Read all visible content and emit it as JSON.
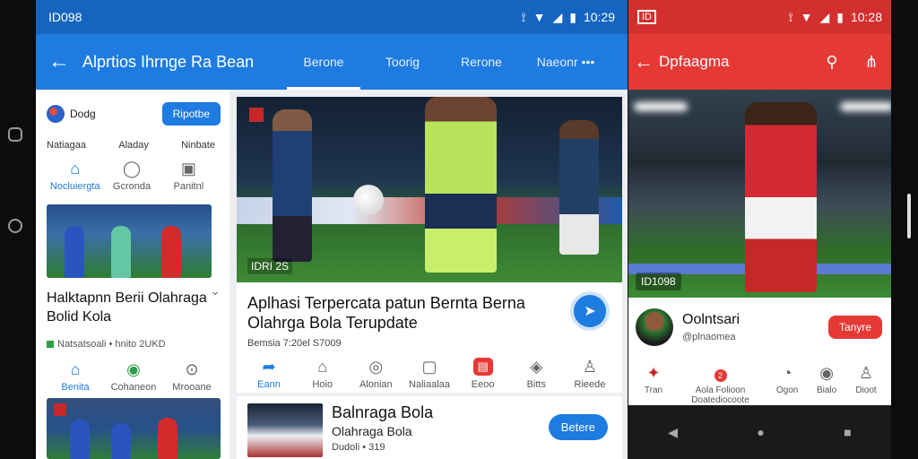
{
  "main": {
    "status": {
      "time_left": "ID098",
      "time_right": "10:29"
    },
    "appbar": {
      "title": "Alprtios Ihrnge Ra Bean"
    },
    "tabs": [
      {
        "label": "Berone",
        "active": true
      },
      {
        "label": "Toorig"
      },
      {
        "label": "Rerone"
      },
      {
        "label": "Naeonr •••"
      }
    ],
    "left_card": {
      "brand": "Dodg",
      "button": "Ripotbe",
      "tri_labels": [
        "Natiagaa",
        "Aladay",
        "Ninbate"
      ],
      "icons": [
        {
          "label": "Nocluiergta",
          "icon": "home-icon",
          "active": true
        },
        {
          "label": "Gcronda",
          "icon": "chat-icon"
        },
        {
          "label": "Panitnl",
          "icon": "image-icon"
        }
      ],
      "headline": "Halktapnn Berii Olahraga Bolid Kola",
      "meta": "Natsatsoali • hnito  2UKD",
      "icons2": [
        {
          "label": "Benita",
          "icon": "home-icon",
          "active": true
        },
        {
          "label": "Cohaneon",
          "icon": "circle-icon"
        },
        {
          "label": "Mrooane",
          "icon": "download-icon"
        }
      ]
    },
    "hero": {
      "label": "IDRI 2S"
    },
    "mid_card": {
      "title": "Aplhasi Terpercata patun Bernta Berna Olahrga Bola Terupdate",
      "meta": "Bemsia  7:20el S7009",
      "icons": [
        {
          "label": "Eann",
          "icon": "share-icon",
          "active": true
        },
        {
          "label": "Hoio",
          "icon": "home-icon"
        },
        {
          "label": "Alonian",
          "icon": "location-icon"
        },
        {
          "label": "Naliaalaa",
          "icon": "gamepad-icon"
        },
        {
          "label": "Eeoo",
          "icon": "bookmark-icon",
          "red": true
        },
        {
          "label": "Bitts",
          "icon": "shield-icon"
        },
        {
          "label": "Rieede",
          "icon": "profile-icon"
        }
      ]
    },
    "card2": {
      "title": "Balnraga Bola",
      "sub": "Olahraga Bola",
      "meta": "Dudoli • 319",
      "button": "Betere"
    }
  },
  "right": {
    "status": {
      "badge": "ID",
      "time": "10:28"
    },
    "appbar": {
      "title": "Dpfaagma"
    },
    "hero": {
      "label": "ID1098"
    },
    "profile": {
      "name": "Oolntsari",
      "sub": "@plnaomea",
      "button": "Tanyre"
    },
    "icons": [
      {
        "label": "Tran",
        "icon": "tools-icon"
      },
      {
        "label": "Aola Folioon Doatediocoote",
        "icon": "text-icon",
        "badge": "2"
      },
      {
        "label": "Ogon",
        "icon": "timer-icon"
      },
      {
        "label": "Bialo",
        "icon": "coin-icon"
      },
      {
        "label": "Dioot",
        "icon": "profile-icon"
      }
    ]
  },
  "colors": {
    "primary_blue": "#1e7be0",
    "accent_red": "#e53935"
  }
}
